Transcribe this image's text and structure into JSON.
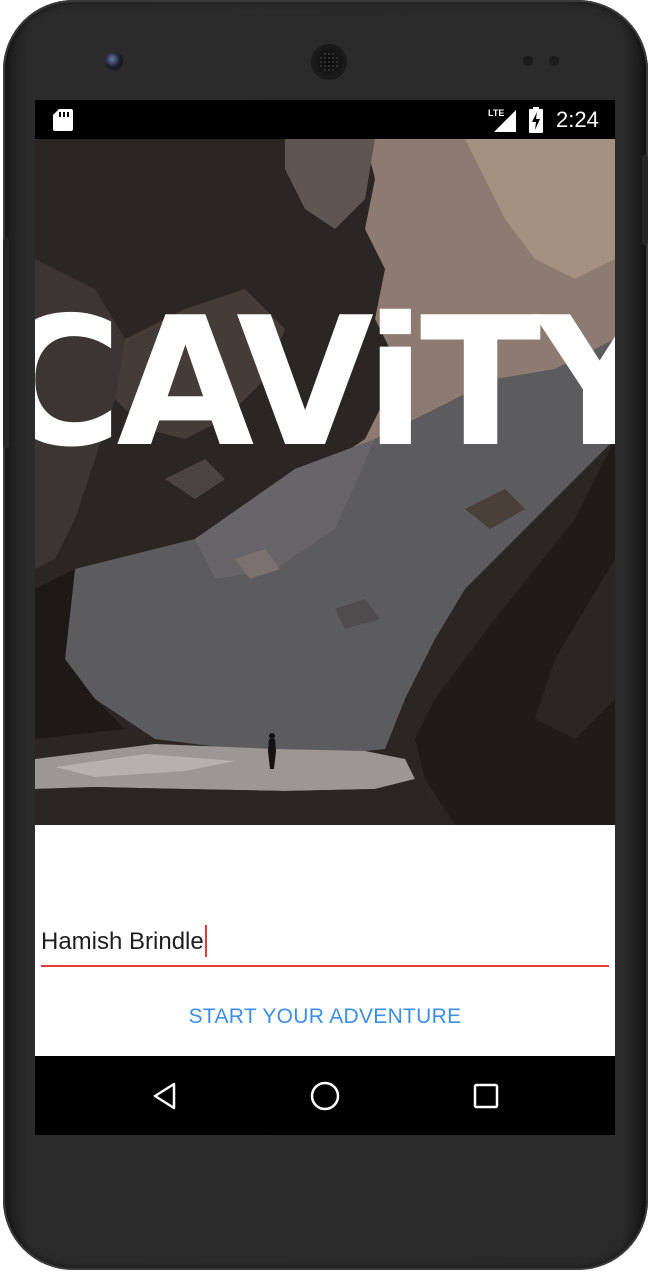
{
  "app": {
    "title": "CAViTY"
  },
  "status_bar": {
    "time": "2:24",
    "network": "LTE",
    "icons": [
      "sd-card-icon",
      "lte-signal-icon",
      "battery-charging-icon"
    ]
  },
  "form": {
    "name_value": "Hamish Brindle",
    "start_label": "START YOUR ADVENTURE"
  },
  "navigation": {
    "buttons": [
      "back-icon",
      "home-icon",
      "recents-icon"
    ]
  },
  "colors": {
    "accent_red": "#e53935",
    "button_blue": "#3c8ee6",
    "status_bar": "#000000"
  }
}
